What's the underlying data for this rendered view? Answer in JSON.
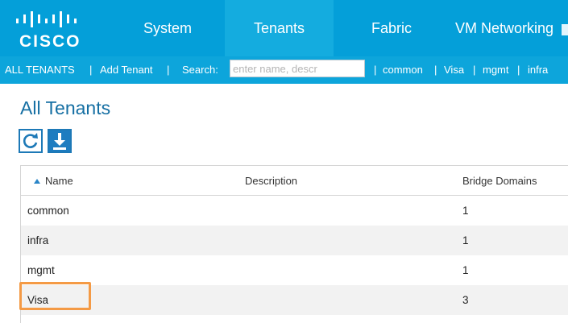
{
  "brand": {
    "logo_text": "CISCO"
  },
  "nav": {
    "tabs": [
      {
        "label": "System",
        "active": false
      },
      {
        "label": "Tenants",
        "active": true
      },
      {
        "label": "Fabric",
        "active": false
      },
      {
        "label": "VM Networking",
        "active": false
      }
    ]
  },
  "subnav": {
    "all_tenants": "ALL TENANTS",
    "sep": "|",
    "add_tenant": "Add Tenant",
    "search_label": "Search:",
    "search_placeholder": "enter name, descr",
    "search_value": "",
    "quick_links": [
      "common",
      "Visa",
      "mgmt",
      "infra"
    ]
  },
  "page": {
    "title": "All Tenants"
  },
  "toolbar": {
    "refresh_icon": "refresh-icon",
    "download_icon": "download-icon"
  },
  "table": {
    "columns": [
      "Name",
      "Description",
      "Bridge Domains"
    ],
    "sort_icon": "sort-ascending-icon",
    "rows": [
      {
        "name": "common",
        "description": "",
        "bridge_domains": "1"
      },
      {
        "name": "infra",
        "description": "",
        "bridge_domains": "1"
      },
      {
        "name": "mgmt",
        "description": "",
        "bridge_domains": "1"
      },
      {
        "name": "Visa",
        "description": "",
        "bridge_domains": "3"
      }
    ],
    "highlighted_row": "Visa"
  },
  "colors": {
    "nav_bg": "#049fd9",
    "title": "#156fa3",
    "highlight": "#f49a45"
  }
}
